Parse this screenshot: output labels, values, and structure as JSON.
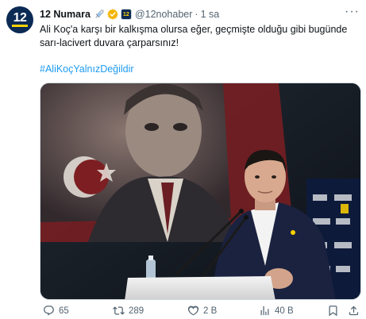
{
  "account": {
    "avatar_text": "12",
    "name": "12 Numara",
    "handle": "@12nohaber",
    "separator": "·",
    "time": "1 sa",
    "affiliate_text": "12"
  },
  "tweet": {
    "text": "Ali Koç'a karşı bir kalkışma olursa eğer, geçmişte olduğu gibi bugünde sarı-lacivert duvara çarparsınız!",
    "hashtag": "#AliKoçYalnızDeğildir"
  },
  "actions": {
    "replies": "65",
    "reposts": "289",
    "likes": "2 B",
    "views": "40 B"
  },
  "icons": {
    "avatar": "12-numara-logo",
    "syringe": "syringe-emoji-icon",
    "verified": "gold-verified-icon",
    "more": "more-icon",
    "reply": "reply-icon",
    "repost": "repost-icon",
    "like": "like-icon",
    "views": "views-icon",
    "bookmark": "bookmark-icon",
    "share": "share-icon"
  },
  "colors": {
    "hashtag": "#1d9bf0",
    "verified": "#f4b400",
    "secondary_text": "#536471",
    "brand_navy": "#0b2a54",
    "brand_yellow": "#ffd200"
  }
}
